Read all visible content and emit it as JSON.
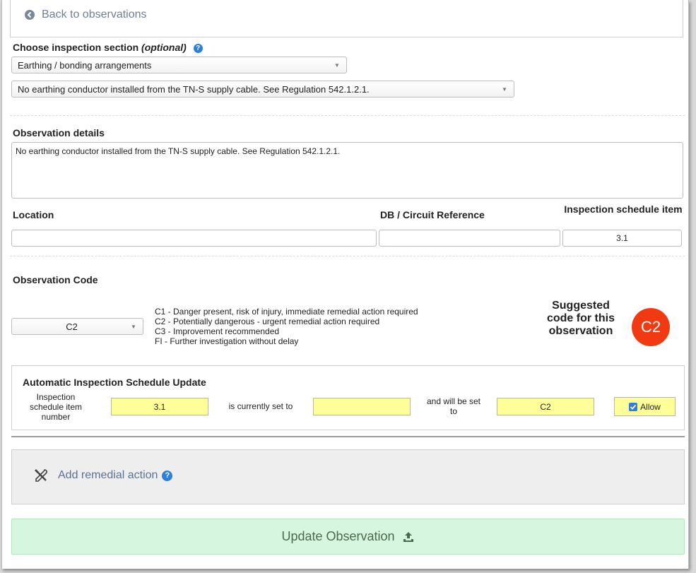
{
  "nav": {
    "back_label": "Back to observations"
  },
  "section": {
    "label": "Choose inspection section",
    "optional_label": "(optional)",
    "selected": "Earthing / bonding arrangements",
    "item_selected": "No earthing conductor installed from the TN-S supply cable. See Regulation 542.1.2.1."
  },
  "details": {
    "label": "Observation details",
    "value": "No earthing conductor installed from the TN-S supply cable. See Regulation 542.1.2.1."
  },
  "fields": {
    "location_label": "Location",
    "location_value": "",
    "db_label": "DB / Circuit Reference",
    "db_value": "",
    "schedule_label": "Inspection schedule item",
    "schedule_value": "3.1"
  },
  "code": {
    "label": "Observation Code",
    "selected": "C2",
    "descriptions": [
      "C1 - Danger present, risk of injury, immediate remedial action required",
      "C2 - Potentially dangerous - urgent remedial action required",
      "C3 - Improvement recommended",
      "FI - Further investigation without delay"
    ],
    "suggested_label": "Suggested code for this observation",
    "suggested_value": "C2",
    "badge_color": "#f23a12"
  },
  "auto_update": {
    "title": "Automatic Inspection Schedule Update",
    "item_number_label": "Inspection schedule item number",
    "item_number_value": "3.1",
    "current_label": "is currently set to",
    "current_value": "",
    "will_be_label": "and will be set to",
    "will_be_value": "C2",
    "allow_label": "Allow",
    "allow_checked": true
  },
  "remedial": {
    "label": "Add remedial action"
  },
  "submit": {
    "label": "Update Observation"
  },
  "colors": {
    "accent_blue": "#2f7ed8",
    "yellow_field": "#ffff99",
    "submit_bg": "#d6f6df"
  }
}
